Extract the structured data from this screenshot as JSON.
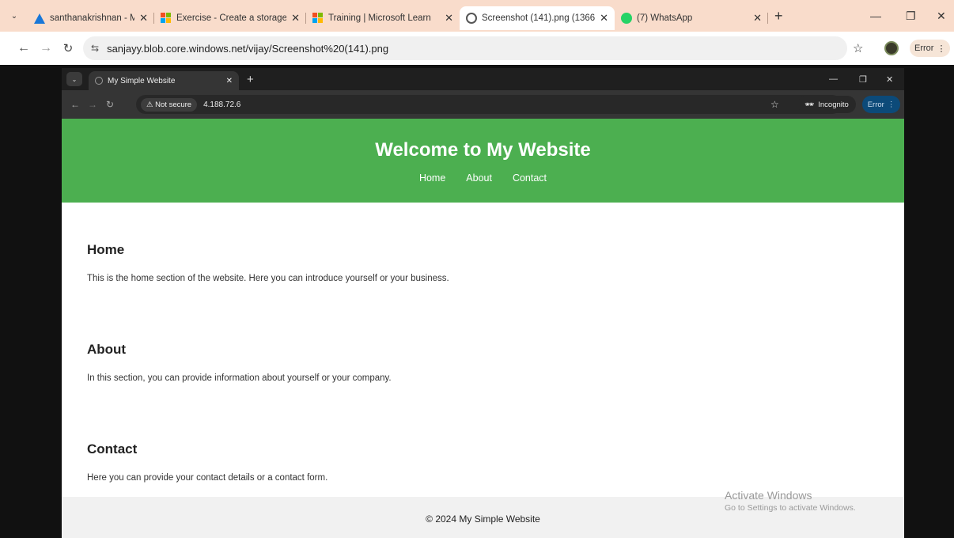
{
  "outer_browser": {
    "tabs": [
      {
        "title": "santhanakrishnan - Microsof",
        "icon": "azure-icon",
        "active": false
      },
      {
        "title": "Exercise - Create a storage b",
        "icon": "microsoft-icon",
        "active": false
      },
      {
        "title": "Training | Microsoft Learn",
        "icon": "microsoft-icon",
        "active": false
      },
      {
        "title": "Screenshot (141).png (1366",
        "icon": "globe-icon",
        "active": true
      },
      {
        "title": "(7) WhatsApp",
        "icon": "whatsapp-icon",
        "active": false
      }
    ],
    "url": "sanjayy.blob.core.windows.net/vijay/Screenshot%20(141).png",
    "error_label": "Error"
  },
  "inner_browser": {
    "tab_title": "My Simple Website",
    "not_secure_label": "Not secure",
    "url": "4.188.72.6",
    "incognito_label": "Incognito",
    "error_label": "Error"
  },
  "site": {
    "title": "Welcome to My Website",
    "nav": [
      "Home",
      "About",
      "Contact"
    ],
    "sections": [
      {
        "heading": "Home",
        "text": "This is the home section of the website. Here you can introduce yourself or your business."
      },
      {
        "heading": "About",
        "text": "In this section, you can provide information about yourself or your company."
      },
      {
        "heading": "Contact",
        "text": "Here you can provide your contact details or a contact form."
      }
    ],
    "footer": "© 2024 My Simple Website",
    "header_color": "#4caf50"
  },
  "watermark": {
    "line1": "Activate Windows",
    "line2": "Go to Settings to activate Windows."
  }
}
